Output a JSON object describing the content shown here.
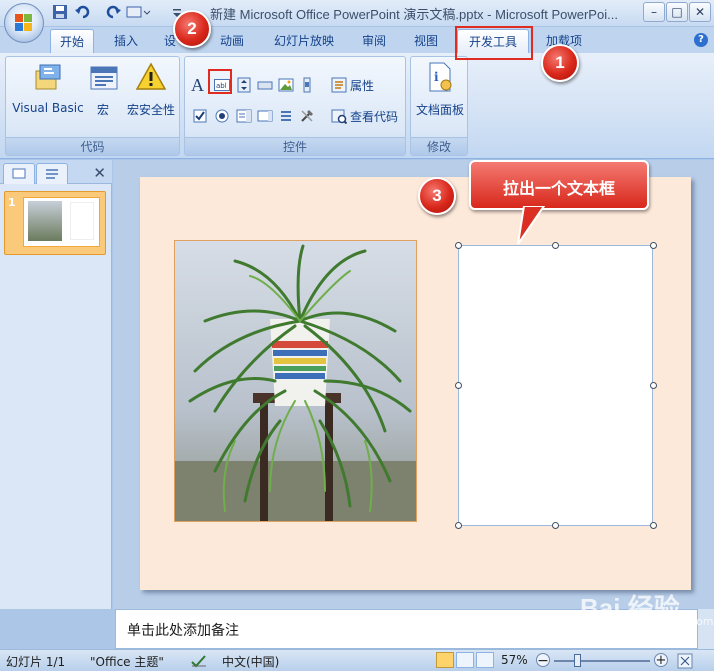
{
  "window": {
    "title": "新建 Microsoft Office PowerPoint 演示文稿.pptx - Microsoft PowerPoi...",
    "minimize": "–",
    "maximize": "□",
    "close": "✕"
  },
  "tabs": [
    {
      "label": "开始"
    },
    {
      "label": "插入"
    },
    {
      "label": "设"
    },
    {
      "label": "动画"
    },
    {
      "label": "幻灯片放映"
    },
    {
      "label": "审阅"
    },
    {
      "label": "视图"
    },
    {
      "label": "开发工具",
      "active": true
    },
    {
      "label": "加载项"
    }
  ],
  "ribbon": {
    "groups": [
      {
        "label": "代码",
        "buttons": [
          {
            "label": "Visual Basic",
            "icon": "visual-basic-icon"
          },
          {
            "label": "宏",
            "icon": "macros-icon"
          },
          {
            "label": "宏安全性",
            "icon": "warning-icon"
          }
        ]
      },
      {
        "label": "控件",
        "items": [
          {
            "label": "属性",
            "icon": "properties-icon"
          },
          {
            "label": "查看代码",
            "icon": "view-code-icon"
          }
        ]
      },
      {
        "label": "修改",
        "buttons": [
          {
            "label": "文档面板",
            "icon": "document-panel-icon"
          }
        ]
      }
    ]
  },
  "slides_pane": {
    "slide_number": "1",
    "close": "✕"
  },
  "notes": {
    "placeholder": "单击此处添加备注"
  },
  "status": {
    "slide": "幻灯片 1/1",
    "theme": "\"Office 主题\"",
    "language": "中文(中国)",
    "zoom": "57%",
    "zoom_minus": "−",
    "zoom_plus": "+"
  },
  "annotations": {
    "step1": "1",
    "step2": "2",
    "step3": "3",
    "callout": "拉出一个文本框"
  },
  "watermark": {
    "text": "Bai 经验",
    "sub": "jingyan.baidu.com"
  },
  "colors": {
    "accent_red": "#e02b20",
    "slide_background": "#fde9d9",
    "ribbon_blue": "#d5e3f5"
  }
}
